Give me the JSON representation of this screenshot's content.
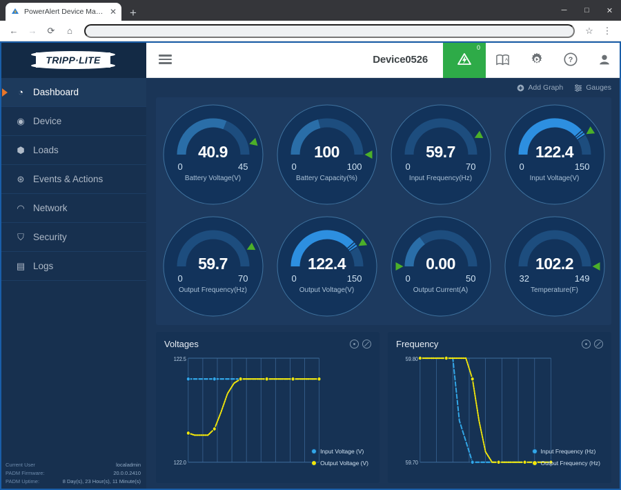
{
  "browser": {
    "tab_title": "PowerAlert Device Manager",
    "tab_favicon": "poweralert-icon",
    "new_tab_label": "+",
    "close_tab_label": "✕",
    "back_label": "←",
    "forward_label": "→",
    "reload_label": "⟳",
    "home_label": "⌂",
    "star_label": "☆",
    "menu_label": "⋮",
    "minimize_label": "─",
    "maximize_label": "□",
    "window_close_label": "✕",
    "address_value": "",
    "address_placeholder": ""
  },
  "sidebar": {
    "logo_text": "TRIPP·LITE",
    "items": [
      {
        "label": "Dashboard",
        "icon": "dashboard-icon",
        "glyph": "◔",
        "active": true
      },
      {
        "label": "Device",
        "icon": "device-icon",
        "glyph": "◉",
        "active": false
      },
      {
        "label": "Loads",
        "icon": "loads-icon",
        "glyph": "⬢",
        "active": false
      },
      {
        "label": "Events & Actions",
        "icon": "events-icon",
        "glyph": "⊛",
        "active": false
      },
      {
        "label": "Network",
        "icon": "network-icon",
        "glyph": "◠",
        "active": false
      },
      {
        "label": "Security",
        "icon": "security-icon",
        "glyph": "⛉",
        "active": false
      },
      {
        "label": "Logs",
        "icon": "logs-icon",
        "glyph": "▤",
        "active": false
      }
    ],
    "footer": {
      "current_user_label": "Current User",
      "current_user_value": "localadmin",
      "firmware_label": "PADM Firmware:",
      "firmware_value": "20.0.0.2410",
      "uptime_label": "PADM Uptime:",
      "uptime_value": "8 Day(s), 23 Hour(s), 11 Minute(s)"
    }
  },
  "header": {
    "menu_icon": "hamburger-icon",
    "device_name": "Device0526",
    "alert_count": "0",
    "alert_icon": "alert-flag-icon",
    "icons": [
      {
        "name": "guide-book-icon",
        "glyph": "📖"
      },
      {
        "name": "gear-icon",
        "glyph": "⚙"
      },
      {
        "name": "help-icon",
        "glyph": "?"
      },
      {
        "name": "account-icon",
        "glyph": "●"
      }
    ]
  },
  "toolbar": {
    "add_graph_label": "Add Graph",
    "add_graph_icon": "plus-circle-icon",
    "gauges_label": "Gauges",
    "gauges_icon": "sliders-icon"
  },
  "gauges": [
    {
      "value": "40.9",
      "min": "0",
      "max": "45",
      "label": "Battery Voltage(V)",
      "pct": 0.909,
      "track_pct": 0.62,
      "bright": false
    },
    {
      "value": "100",
      "min": "0",
      "max": "100",
      "label": "Battery Capacity(%)",
      "pct": 1.0,
      "track_pct": 0.42,
      "bright": false
    },
    {
      "value": "59.7",
      "min": "0",
      "max": "70",
      "label": "Input Frequency(Hz)",
      "pct": 0.853,
      "track_pct": 0.0,
      "bright": false
    },
    {
      "value": "122.4",
      "min": "0",
      "max": "150",
      "label": "Input Voltage(V)",
      "pct": 0.816,
      "track_pct": 0.82,
      "bright": true
    },
    {
      "value": "59.7",
      "min": "0",
      "max": "70",
      "label": "Output Frequency(Hz)",
      "pct": 0.853,
      "track_pct": 0.0,
      "bright": false
    },
    {
      "value": "122.4",
      "min": "0",
      "max": "150",
      "label": "Output Voltage(V)",
      "pct": 0.816,
      "track_pct": 0.82,
      "bright": true
    },
    {
      "value": "0.00",
      "min": "0",
      "max": "50",
      "label": "Output Current(A)",
      "pct": 0.0,
      "track_pct": 0.3,
      "bright": false
    },
    {
      "value": "102.2",
      "min": "32",
      "max": "149",
      "label": "Temperature(F)",
      "pct": 1.0,
      "track_pct": 0.0,
      "bright": false
    }
  ],
  "colors": {
    "accent_orange": "#e8762a",
    "alert_green": "#2eab48",
    "marker_green": "#4caf29",
    "gauge_blue": "#2d87d6",
    "gauge_track": "#1d4d7e",
    "series_blue": "#32a7e8",
    "series_yellow": "#f2e60a"
  },
  "chart_data": [
    {
      "type": "line",
      "title": "Voltages",
      "xlabel": "",
      "ylabel": "",
      "ylim": [
        122.0,
        122.5
      ],
      "ytick_labels": [
        "122.5",
        "122.0"
      ],
      "grid": true,
      "legend_position": "bottom-right",
      "gridlines_x": 9,
      "series": [
        {
          "name": "Input Voltage (V)",
          "color": "#32a7e8",
          "style": "dashed",
          "values": [
            122.4,
            122.4,
            122.4,
            122.4,
            122.4,
            122.4,
            122.4,
            122.4,
            122.4,
            122.4,
            122.4,
            122.4,
            122.4,
            122.4,
            122.4,
            122.4,
            122.4,
            122.4,
            122.4,
            122.4,
            122.4
          ]
        },
        {
          "name": "Output Voltage (V)",
          "color": "#f2e60a",
          "style": "dotted",
          "values": [
            122.14,
            122.13,
            122.13,
            122.13,
            122.16,
            122.24,
            122.33,
            122.38,
            122.4,
            122.4,
            122.4,
            122.4,
            122.4,
            122.4,
            122.4,
            122.4,
            122.4,
            122.4,
            122.4,
            122.4,
            122.4
          ]
        }
      ]
    },
    {
      "type": "line",
      "title": "Frequency",
      "xlabel": "",
      "ylabel": "",
      "ylim": [
        59.7,
        59.8
      ],
      "ytick_labels": [
        "59.80",
        "59.70"
      ],
      "grid": true,
      "legend_position": "bottom-right",
      "gridlines_x": 8,
      "series": [
        {
          "name": "Input Frequency (Hz)",
          "color": "#32a7e8",
          "style": "dashed",
          "values": [
            59.8,
            59.8,
            59.8,
            59.8,
            59.8,
            59.8,
            59.74,
            59.72,
            59.7,
            59.7,
            59.7,
            59.7,
            59.7,
            59.7,
            59.7,
            59.7,
            59.7,
            59.7,
            59.7,
            59.7,
            59.7
          ]
        },
        {
          "name": "Output Frequency (Hz)",
          "color": "#f2e60a",
          "style": "dotted",
          "values": [
            59.8,
            59.8,
            59.8,
            59.8,
            59.8,
            59.8,
            59.8,
            59.8,
            59.78,
            59.74,
            59.71,
            59.7,
            59.7,
            59.7,
            59.7,
            59.7,
            59.7,
            59.7,
            59.7,
            59.7,
            59.7
          ]
        }
      ]
    }
  ]
}
